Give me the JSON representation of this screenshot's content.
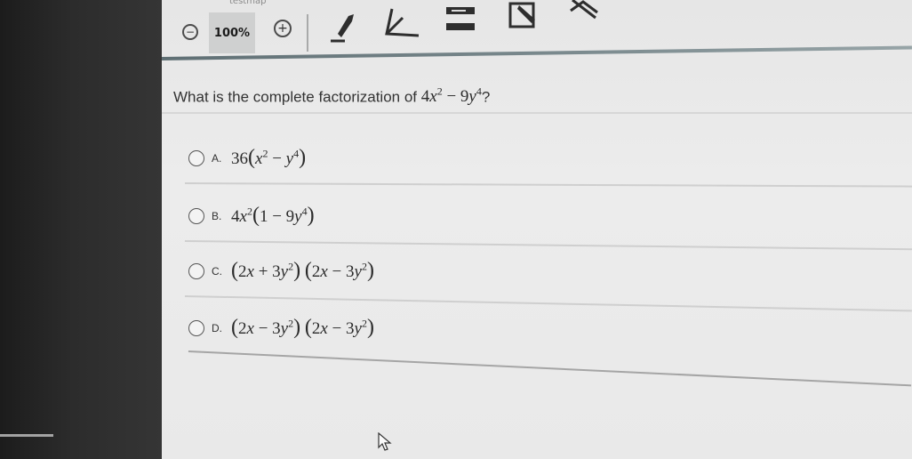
{
  "app": {
    "title": "testmap"
  },
  "toolbar": {
    "zoom_level": "100%",
    "zoom_out_icon": "minus-icon",
    "zoom_in_icon": "plus-icon",
    "tools": [
      "pencil-icon",
      "angle-icon",
      "line-reader-icon",
      "highlighter-icon",
      "eliminator-icon"
    ]
  },
  "question": {
    "prompt": "What is the complete factorization of",
    "expression_html": "4<i>x</i><sup>2</sup> − 9<i>y</i><sup>4</sup>",
    "end": "?"
  },
  "options": [
    {
      "letter": "A.",
      "expr_html": "36<span class=\"paren\">(</span><i>x</i><sup>2</sup> − <i>y</i><sup>4</sup><span class=\"paren\">)</span>"
    },
    {
      "letter": "B.",
      "expr_html": "4<i>x</i><sup>2</sup><span class=\"paren\">(</span>1 − 9<i>y</i><sup>4</sup><span class=\"paren\">)</span>"
    },
    {
      "letter": "C.",
      "expr_html": "<span class=\"paren\">(</span>2<i>x</i> + 3<i>y</i><sup>2</sup><span class=\"paren\">)</span> <span class=\"paren\">(</span>2<i>x</i> − 3<i>y</i><sup>2</sup><span class=\"paren\">)</span>"
    },
    {
      "letter": "D.",
      "expr_html": "<span class=\"paren\">(</span>2<i>x</i> − 3<i>y</i><sup>2</sup><span class=\"paren\">)</span> <span class=\"paren\">(</span>2<i>x</i> − 3<i>y</i><sup>2</sup><span class=\"paren\">)</span>"
    }
  ]
}
